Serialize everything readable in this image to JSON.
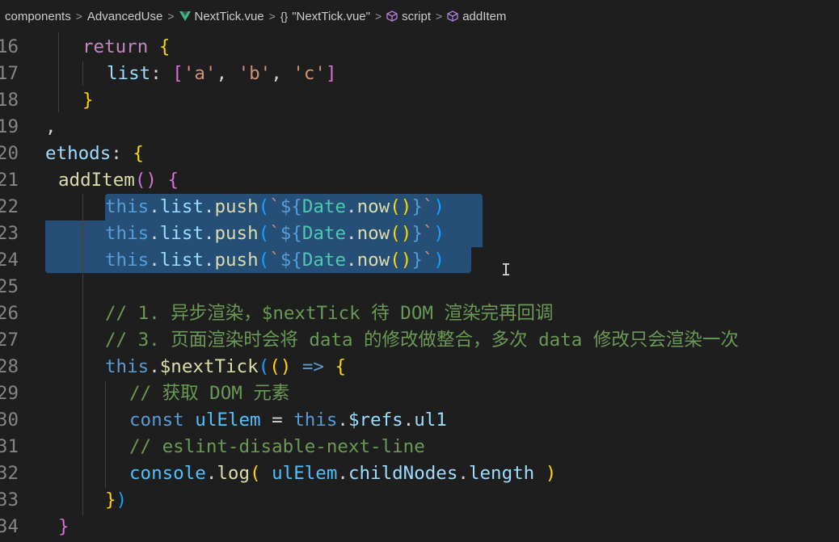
{
  "breadcrumb": [
    {
      "label": "components",
      "icon": null
    },
    {
      "label": "AdvancedUse",
      "icon": null
    },
    {
      "label": "NextTick.vue",
      "icon": "vue-icon"
    },
    {
      "label": "\"NextTick.vue\"",
      "icon": "braces-icon"
    },
    {
      "label": "script",
      "icon": "cube-icon"
    },
    {
      "label": "addItem",
      "icon": "cube-icon"
    }
  ],
  "colors": {
    "background": "#1e1e1e",
    "selection": "#264f78",
    "line_number": "#858585",
    "keyword": "#c586c0",
    "comment": "#6a9955",
    "string": "#ce9178",
    "function": "#dcdcaa"
  },
  "editor": {
    "selected_lines": [
      22,
      23,
      24
    ],
    "lines": [
      {
        "num": "16",
        "tokens": [
          [
            "t-kw",
            "return"
          ],
          [
            "t-plain",
            " "
          ],
          [
            "t-br1",
            "{"
          ]
        ]
      },
      {
        "num": "17",
        "tokens": [
          [
            "t-key",
            "list"
          ],
          [
            "t-plain",
            ": "
          ],
          [
            "t-br2",
            "["
          ],
          [
            "t-str",
            "'a'"
          ],
          [
            "t-plain",
            ", "
          ],
          [
            "t-str",
            "'b'"
          ],
          [
            "t-plain",
            ", "
          ],
          [
            "t-str",
            "'c'"
          ],
          [
            "t-br2",
            "]"
          ]
        ]
      },
      {
        "num": "18",
        "tokens": [
          [
            "t-br1",
            "}"
          ]
        ]
      },
      {
        "num": "19",
        "tokens": [
          [
            "t-plain",
            ","
          ]
        ]
      },
      {
        "num": "20",
        "tokens": [
          [
            "t-key",
            "ethods"
          ],
          [
            "t-plain",
            ": "
          ],
          [
            "t-br1",
            "{"
          ]
        ]
      },
      {
        "num": "21",
        "tokens": [
          [
            "t-fn",
            "addItem"
          ],
          [
            "t-br2",
            "()"
          ],
          [
            "t-plain",
            " "
          ],
          [
            "t-br2",
            "{"
          ]
        ]
      },
      {
        "num": "22",
        "tokens": [
          [
            "t-this",
            "this"
          ],
          [
            "t-plain",
            "."
          ],
          [
            "t-prop",
            "list"
          ],
          [
            "t-plain",
            "."
          ],
          [
            "t-fn",
            "push"
          ],
          [
            "t-br3",
            "("
          ],
          [
            "t-str",
            "`"
          ],
          [
            "t-this",
            "${"
          ],
          [
            "t-cls",
            "Date"
          ],
          [
            "t-plain",
            "."
          ],
          [
            "t-fn",
            "now"
          ],
          [
            "t-br1",
            "()"
          ],
          [
            "t-this",
            "}"
          ],
          [
            "t-str",
            "`"
          ],
          [
            "t-br3",
            ")"
          ]
        ]
      },
      {
        "num": "23",
        "tokens": [
          [
            "t-this",
            "this"
          ],
          [
            "t-plain",
            "."
          ],
          [
            "t-prop",
            "list"
          ],
          [
            "t-plain",
            "."
          ],
          [
            "t-fn",
            "push"
          ],
          [
            "t-br3",
            "("
          ],
          [
            "t-str",
            "`"
          ],
          [
            "t-this",
            "${"
          ],
          [
            "t-cls",
            "Date"
          ],
          [
            "t-plain",
            "."
          ],
          [
            "t-fn",
            "now"
          ],
          [
            "t-br1",
            "()"
          ],
          [
            "t-this",
            "}"
          ],
          [
            "t-str",
            "`"
          ],
          [
            "t-br3",
            ")"
          ]
        ]
      },
      {
        "num": "24",
        "tokens": [
          [
            "t-this",
            "this"
          ],
          [
            "t-plain",
            "."
          ],
          [
            "t-prop",
            "list"
          ],
          [
            "t-plain",
            "."
          ],
          [
            "t-fn",
            "push"
          ],
          [
            "t-br3",
            "("
          ],
          [
            "t-str",
            "`"
          ],
          [
            "t-this",
            "${"
          ],
          [
            "t-cls",
            "Date"
          ],
          [
            "t-plain",
            "."
          ],
          [
            "t-fn",
            "now"
          ],
          [
            "t-br1",
            "()"
          ],
          [
            "t-this",
            "}"
          ],
          [
            "t-str",
            "`"
          ],
          [
            "t-br3",
            ")"
          ]
        ]
      },
      {
        "num": "25",
        "tokens": []
      },
      {
        "num": "26",
        "tokens": [
          [
            "t-com",
            "// 1. 异步渲染，$nextTick 待 DOM 渲染完再回调"
          ]
        ]
      },
      {
        "num": "27",
        "tokens": [
          [
            "t-com",
            "// 3. 页面渲染时会将 data 的修改做整合，多次 data 修改只会渲染一次"
          ]
        ]
      },
      {
        "num": "28",
        "tokens": [
          [
            "t-this",
            "this"
          ],
          [
            "t-plain",
            "."
          ],
          [
            "t-fn",
            "$nextTick"
          ],
          [
            "t-br3",
            "("
          ],
          [
            "t-br1",
            "()"
          ],
          [
            "t-plain",
            " "
          ],
          [
            "t-this",
            "=>"
          ],
          [
            "t-plain",
            " "
          ],
          [
            "t-br1",
            "{"
          ]
        ]
      },
      {
        "num": "29",
        "tokens": [
          [
            "t-com",
            "// 获取 DOM 元素"
          ]
        ]
      },
      {
        "num": "30",
        "tokens": [
          [
            "t-this",
            "const"
          ],
          [
            "t-plain",
            " "
          ],
          [
            "t-var",
            "ulElem"
          ],
          [
            "t-plain",
            " = "
          ],
          [
            "t-this",
            "this"
          ],
          [
            "t-plain",
            "."
          ],
          [
            "t-prop",
            "$refs"
          ],
          [
            "t-plain",
            "."
          ],
          [
            "t-prop",
            "ul1"
          ]
        ]
      },
      {
        "num": "31",
        "tokens": [
          [
            "t-com",
            "// eslint-disable-next-line"
          ]
        ]
      },
      {
        "num": "32",
        "tokens": [
          [
            "t-var",
            "console"
          ],
          [
            "t-plain",
            "."
          ],
          [
            "t-fn",
            "log"
          ],
          [
            "t-br1",
            "("
          ],
          [
            "t-plain",
            " "
          ],
          [
            "t-var",
            "ulElem"
          ],
          [
            "t-plain",
            "."
          ],
          [
            "t-prop",
            "childNodes"
          ],
          [
            "t-plain",
            "."
          ],
          [
            "t-prop",
            "length"
          ],
          [
            "t-plain",
            " "
          ],
          [
            "t-br1",
            ")"
          ]
        ]
      },
      {
        "num": "33",
        "tokens": [
          [
            "t-br1",
            "}"
          ],
          [
            "t-br3",
            ")"
          ]
        ]
      },
      {
        "num": "34",
        "tokens": [
          [
            "t-br2",
            "}"
          ]
        ]
      }
    ]
  }
}
